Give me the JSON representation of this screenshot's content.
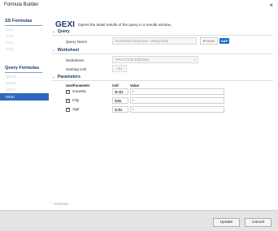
{
  "window": {
    "title": "Formula Builder",
    "close_glyph": "×"
  },
  "sidebar": {
    "ss_heading": "SS Formulas",
    "ss_items": [
      "GXL",
      "GXE",
      "GXC",
      "GXD"
    ],
    "query_heading": "Query Formulas",
    "query_items": [
      "QEXQ",
      "QEXD",
      "QEXC",
      "GEXI"
    ],
    "active_item": "GEXI"
  },
  "main": {
    "formula_name": "GEXI",
    "description": "Opens the detail results of the query in a results window.",
    "query_section": {
      "title": "Query",
      "name_label": "Query Name",
      "name_value": "Northwind Employee Listing.EDQ",
      "browse_label": "Browse",
      "sap_label": "SAP"
    },
    "worksheet_section": {
      "title": "Worksheet",
      "worksheet_label": "Worksheet",
      "worksheet_value": "PRACTICE-Drilldown",
      "start_label": "Starting Cell",
      "start_value": "L61"
    },
    "parameters_section": {
      "title": "Parameters",
      "col_use": "Use/Parameter",
      "col_cell": "Cell",
      "col_value": "Value",
      "rows": [
        {
          "checked": "✓",
          "name": "Country",
          "cell": "$H$1",
          "value": "*"
        },
        {
          "checked": "✓",
          "name": "City",
          "cell": "$I$1",
          "value": "*"
        },
        {
          "checked": "✓",
          "name": "Age",
          "cell": "$J$1",
          "value": "*"
        }
      ]
    },
    "formula_toggle": "Formula"
  },
  "footer": {
    "update_label": "Update",
    "cancel_label": "Cancel"
  },
  "icons": {
    "chevron": "chevron-down-icon",
    "dropdown": "dropdown-arrow-icon",
    "check": "check-icon"
  }
}
